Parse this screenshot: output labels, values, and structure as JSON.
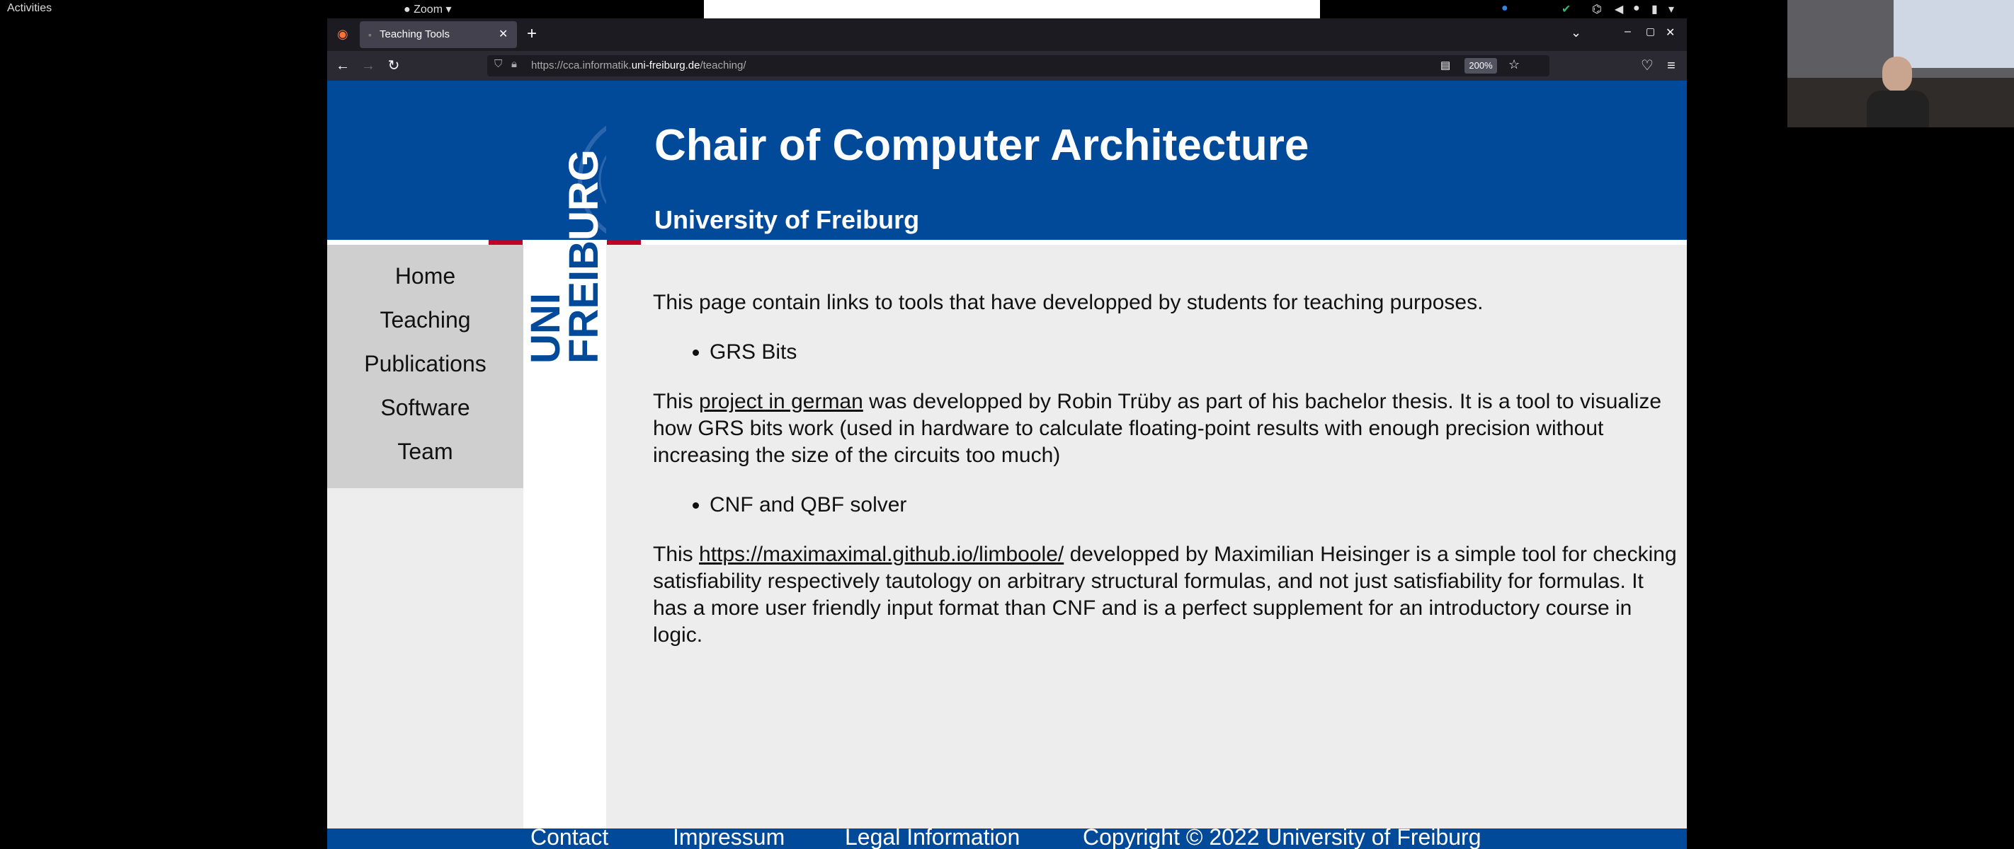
{
  "topbar": {
    "activities": "Activities",
    "app": "Zoom"
  },
  "browser": {
    "tab_title": "Teaching Tools",
    "url_prefix": "https://cca.informatik.",
    "url_domain": "uni-freiburg.de",
    "url_path": "/teaching/",
    "zoom_level": "200%"
  },
  "logo": {
    "line1": "UNI",
    "line2": "FREIBURG"
  },
  "header": {
    "title": "Chair of Computer Architecture",
    "subtitle": "University of Freiburg"
  },
  "sidebar": {
    "items": [
      "Home",
      "Teaching",
      "Publications",
      "Software",
      "Team"
    ]
  },
  "content": {
    "intro": "This page contain links to tools that have developped by students for teaching purposes.",
    "item1": "GRS Bits",
    "para1_pre": "This ",
    "para1_link": "project in german",
    "para1_post": " was developped by Robin Trüby as part of his bachelor thesis. It is a tool to visualize how GRS bits work (used in hardware to calculate floating-point results with enough precision without increasing the size of the circuits too much)",
    "item2": "CNF and QBF solver",
    "para2_pre": "This ",
    "para2_link": "https://maximaximal.github.io/limboole/",
    "para2_post": " developped by Maximilian Heisinger is a simple tool for checking satisfiability respectively tautology on arbitrary structural formulas, and not just satisfiability for formulas. It has a more user friendly input format than CNF and is a perfect supplement for an introductory course in logic."
  },
  "footer": {
    "contact": "Contact",
    "impressum": "Impressum",
    "legal": "Legal Information",
    "copyright": "Copyright © 2022 University of Freiburg"
  },
  "colors": {
    "brand_blue": "#004a99",
    "brand_red": "#c1002a"
  }
}
